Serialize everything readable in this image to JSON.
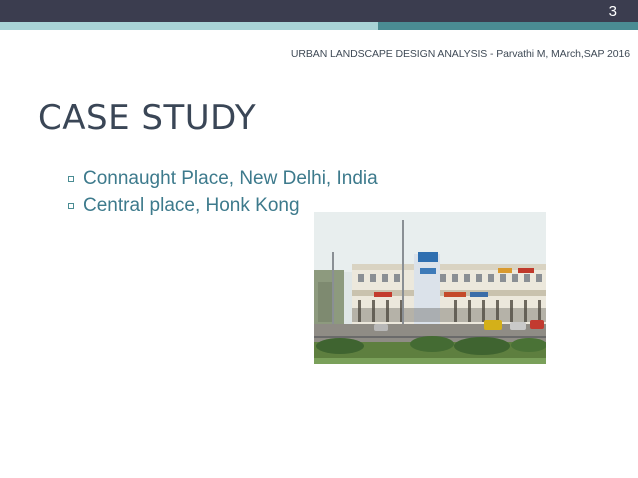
{
  "slide": {
    "page_number": "3",
    "header": "URBAN LANDSCAPE DESIGN ANALYSIS - Parvathi M, MArch,SAP 2016",
    "title": "CASE STUDY",
    "bullets": [
      {
        "text": "Connaught Place, New Delhi, India"
      },
      {
        "text": "Central place, Honk Kong"
      }
    ]
  },
  "colors": {
    "top_bar": "#3b3d4f",
    "accent_teal": "#4a8c93",
    "accent_light": "#a8d3d6",
    "title": "#3a4656",
    "bullet_text": "#3d7a8c"
  },
  "image": {
    "semantic": "connaught-place-photo"
  }
}
